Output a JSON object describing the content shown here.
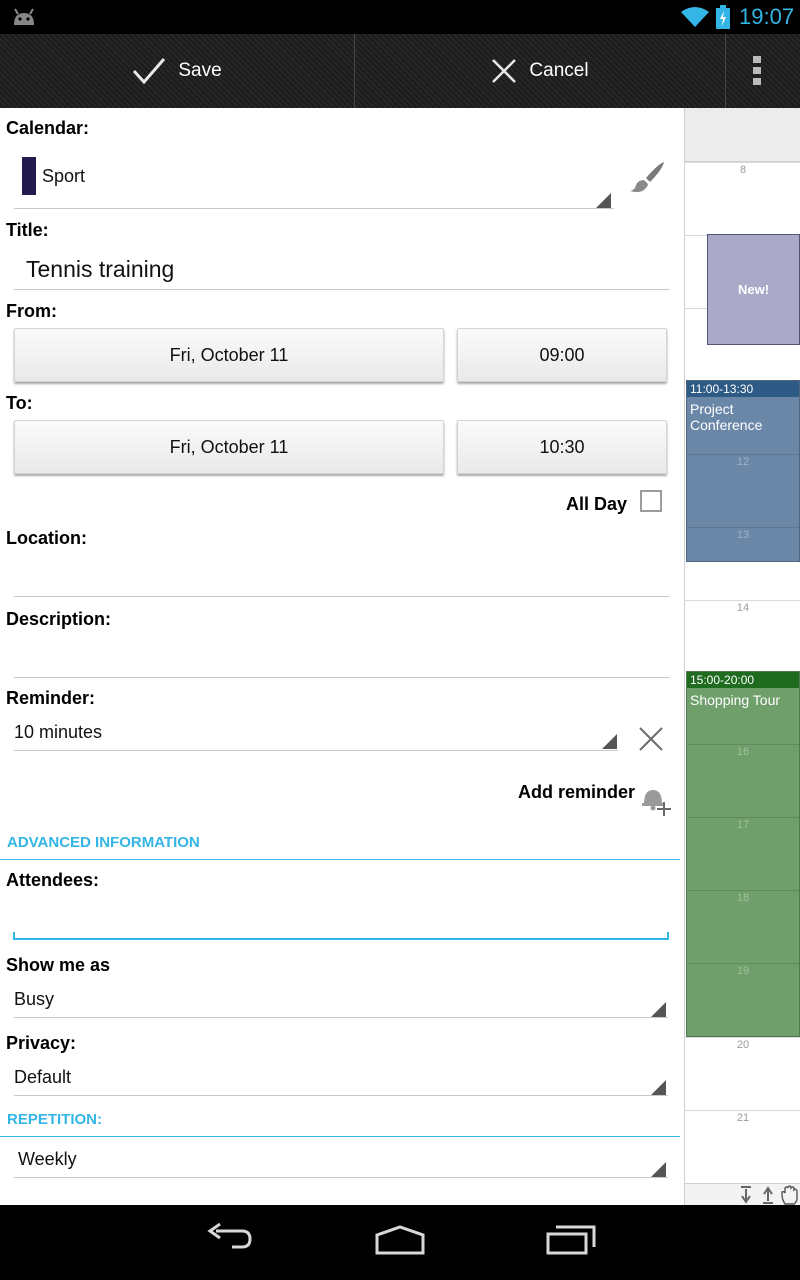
{
  "status_bar": {
    "time": "19:07"
  },
  "action_bar": {
    "save_label": "Save",
    "cancel_label": "Cancel"
  },
  "form": {
    "calendar": {
      "label": "Calendar:",
      "value": "Sport",
      "color": "#231a4d"
    },
    "title": {
      "label": "Title:",
      "value": "Tennis training"
    },
    "from": {
      "label": "From:",
      "date": "Fri, October 11",
      "time": "09:00"
    },
    "to": {
      "label": "To:",
      "date": "Fri, October 11",
      "time": "10:30"
    },
    "all_day": {
      "label": "All Day",
      "checked": false
    },
    "location": {
      "label": "Location:",
      "value": ""
    },
    "description": {
      "label": "Description:",
      "value": ""
    },
    "reminder": {
      "label": "Reminder:",
      "value": "10 minutes",
      "add_label": "Add reminder"
    },
    "advanced_header": "ADVANCED INFORMATION",
    "attendees": {
      "label": "Attendees:",
      "value": ""
    },
    "show_me_as": {
      "label": "Show me as",
      "value": "Busy"
    },
    "privacy": {
      "label": "Privacy:",
      "value": "Default"
    },
    "repetition_header": "REPETITION:",
    "repetition": {
      "value": "Weekly"
    }
  },
  "calendar_strip": {
    "hours": [
      "8",
      "12",
      "13",
      "14",
      "16",
      "17",
      "18",
      "19",
      "20",
      "21"
    ],
    "new_event_label": "New!",
    "events": [
      {
        "time": "11:00-13:30",
        "title_line1": "Project",
        "title_line2": "Conference",
        "color": "#6a87a8",
        "header_color": "#2e5a86"
      },
      {
        "time": "15:00-20:00",
        "title_line1": "Shopping Tour",
        "color": "#6f9f6a",
        "header_color": "#1f6b1f"
      }
    ]
  },
  "colors": {
    "accent": "#33b5e5"
  }
}
